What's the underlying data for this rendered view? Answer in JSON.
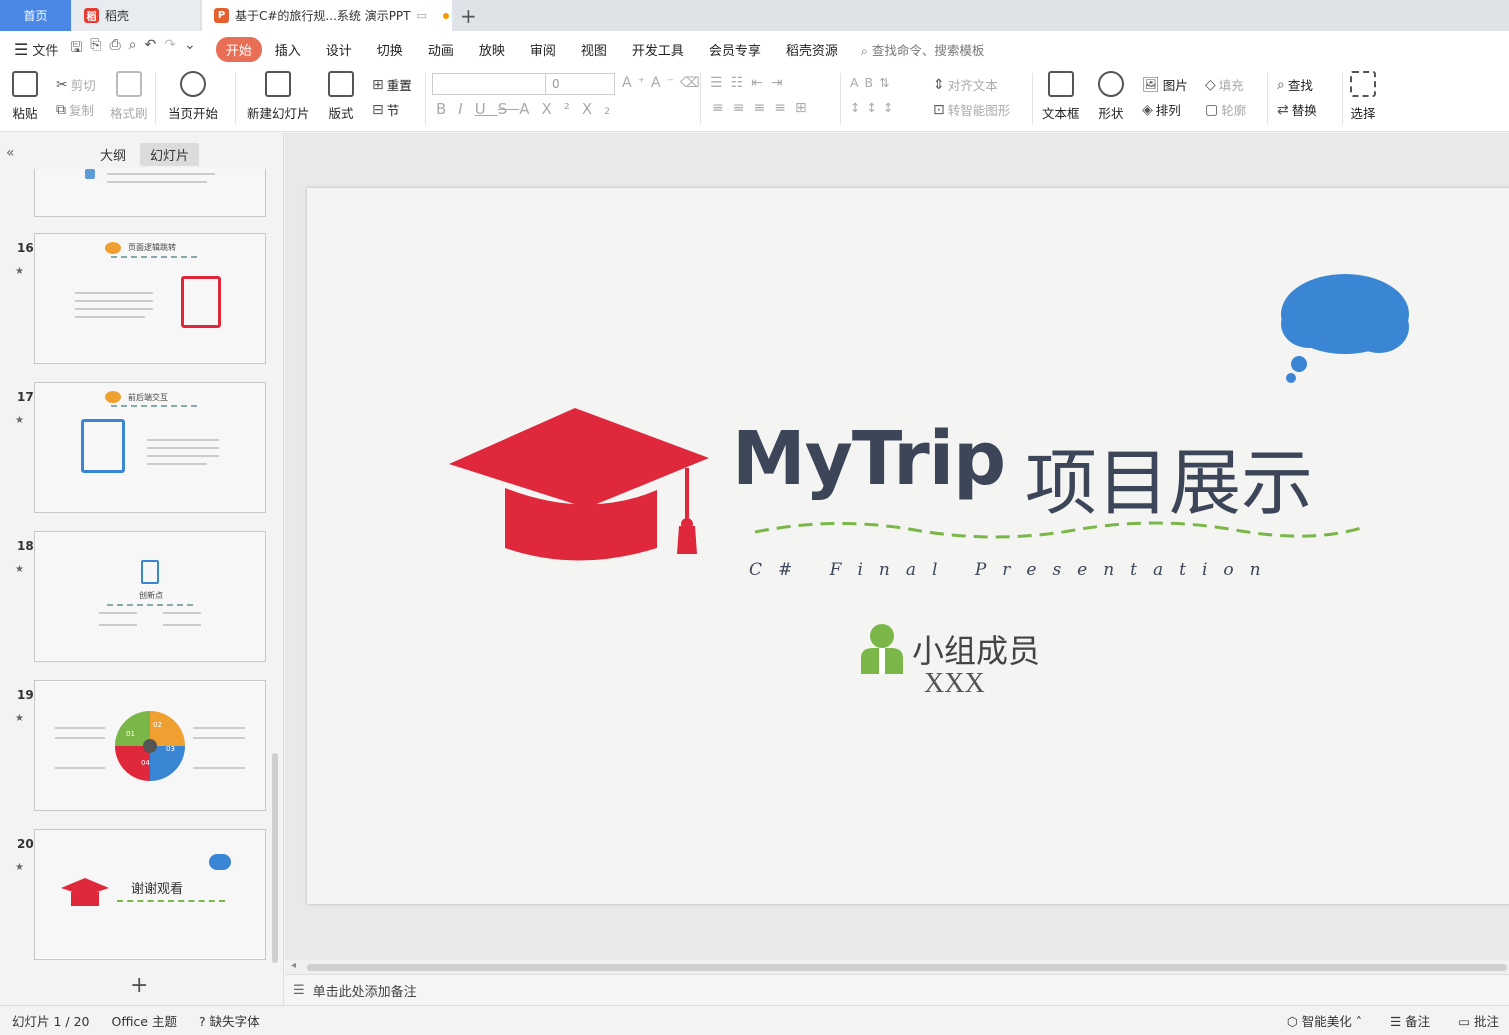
{
  "tabs": {
    "home": "首页",
    "daoke": "稻壳",
    "doc": "基于C#的旅行规...系统 演示PPT"
  },
  "menu": {
    "file": "文件",
    "items": [
      "开始",
      "插入",
      "设计",
      "切换",
      "动画",
      "放映",
      "审阅",
      "视图",
      "开发工具",
      "会员专享",
      "稻壳资源"
    ],
    "search": "查找命令、搜索模板"
  },
  "ribbon": {
    "paste": "粘贴",
    "cut": "剪切",
    "copy": "复制",
    "format_painter": "格式刷",
    "start_from_current": "当页开始",
    "new_slide": "新建幻灯片",
    "layout": "版式",
    "reset": "重置",
    "section": "节",
    "font_size": "0",
    "align_text": "对齐文本",
    "smartart": "转智能图形",
    "textbox": "文本框",
    "shape": "形状",
    "picture": "图片",
    "arrange": "排列",
    "fill": "填充",
    "outline": "轮廓",
    "find": "查找",
    "replace": "替换",
    "select": "选择"
  },
  "sidebar": {
    "tab_outline": "大纲",
    "tab_slides": "幻灯片",
    "slides": [
      {
        "num": "16",
        "title": "页面逻辑跳转"
      },
      {
        "num": "17",
        "title": "前后端交互"
      },
      {
        "num": "18",
        "title": "创新点"
      },
      {
        "num": "19",
        "title": "",
        "labels": [
          "01",
          "02",
          "03",
          "04"
        ]
      },
      {
        "num": "20",
        "title": "谢谢观看"
      }
    ]
  },
  "slide": {
    "title_en": "MyTrip",
    "title_cn": "项目展示",
    "subtitle": "C# Final Presentation",
    "group_label": "小组成员",
    "members": "XXX"
  },
  "notes": {
    "placeholder": "单击此处添加备注"
  },
  "status": {
    "slide_counter": "幻灯片 1 / 20",
    "theme": "Office 主题",
    "missing_font": "缺失字体",
    "beautify": "智能美化",
    "notes": "备注",
    "comments": "批注"
  },
  "colors": {
    "accent": "#e86e55",
    "home_tab": "#4a88e6",
    "cap_red": "#e0283c",
    "cloud_blue": "#3a86d4",
    "wave_green": "#7ab648",
    "title_ink": "#3c4658"
  }
}
